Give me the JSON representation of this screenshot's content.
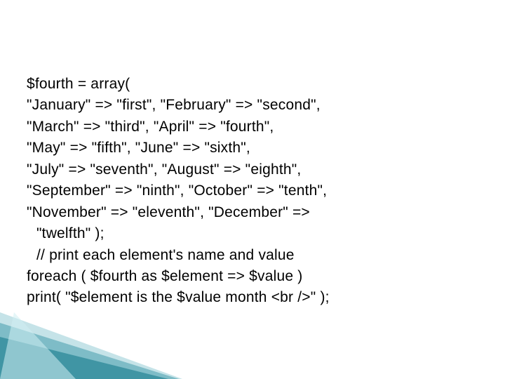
{
  "code": {
    "l1": "$fourth = array(",
    "l2": "\"January\" => \"first\", \"February\" => \"second\",",
    "l3": "\"March\" => \"third\", \"April\" => \"fourth\",",
    "l4": "\"May\" => \"fifth\", \"June\" => \"sixth\",",
    "l5": "\"July\" => \"seventh\", \"August\" => \"eighth\",",
    "l6": "\"September\" => \"ninth\", \"October\" => \"tenth\",",
    "l7": "\"November\" => \"eleventh\", \"December\" =>",
    "l8": "\"twelfth\" );",
    "l9": "// print each element's name and value",
    "l10": "foreach ( $fourth as $element => $value )",
    "l11": "print( \"$element is the $value month <br />\" );"
  }
}
